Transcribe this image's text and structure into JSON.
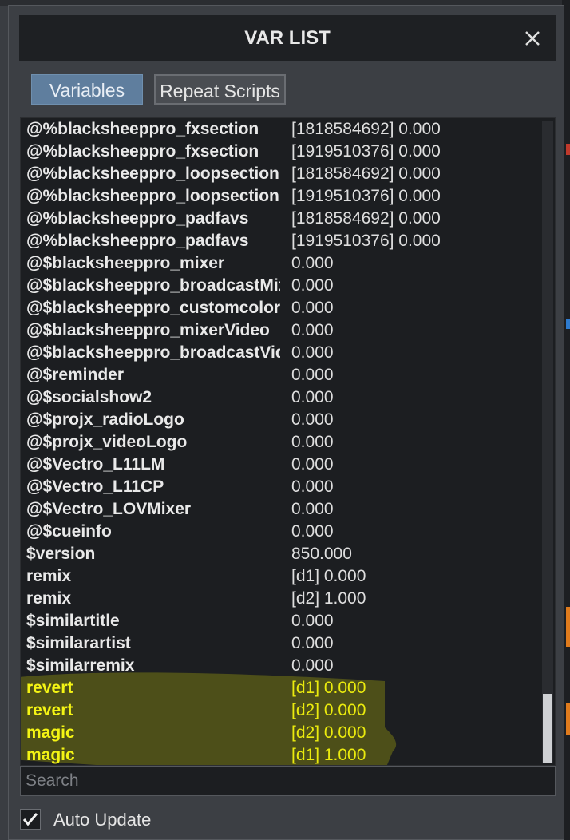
{
  "window": {
    "title": "VAR LIST",
    "close_icon": "close-icon"
  },
  "tabs": [
    {
      "label": "Variables",
      "active": true
    },
    {
      "label": "Repeat Scripts",
      "active": false
    }
  ],
  "variables": [
    {
      "name": "@%blacksheeppro_fxsection",
      "value": "[1818584692] 0.000",
      "highlighted": false
    },
    {
      "name": "@%blacksheeppro_fxsection",
      "value": "[1919510376] 0.000",
      "highlighted": false
    },
    {
      "name": "@%blacksheeppro_loopsection",
      "value": "[1818584692] 0.000",
      "highlighted": false
    },
    {
      "name": "@%blacksheeppro_loopsection",
      "value": "[1919510376] 0.000",
      "highlighted": false
    },
    {
      "name": "@%blacksheeppro_padfavs",
      "value": "[1818584692] 0.000",
      "highlighted": false
    },
    {
      "name": "@%blacksheeppro_padfavs",
      "value": "[1919510376] 0.000",
      "highlighted": false
    },
    {
      "name": "@$blacksheeppro_mixer",
      "value": "0.000",
      "highlighted": false
    },
    {
      "name": "@$blacksheeppro_broadcastMixer",
      "value": "0.000",
      "highlighted": false
    },
    {
      "name": "@$blacksheeppro_customcolors",
      "value": "0.000",
      "highlighted": false
    },
    {
      "name": "@$blacksheeppro_mixerVideo",
      "value": "0.000",
      "highlighted": false
    },
    {
      "name": "@$blacksheeppro_broadcastVideo",
      "value": "0.000",
      "highlighted": false
    },
    {
      "name": "@$reminder",
      "value": "0.000",
      "highlighted": false
    },
    {
      "name": "@$socialshow2",
      "value": "0.000",
      "highlighted": false
    },
    {
      "name": "@$projx_radioLogo",
      "value": "0.000",
      "highlighted": false
    },
    {
      "name": "@$projx_videoLogo",
      "value": "0.000",
      "highlighted": false
    },
    {
      "name": "@$Vectro_L11LM",
      "value": "0.000",
      "highlighted": false
    },
    {
      "name": "@$Vectro_L11CP",
      "value": "0.000",
      "highlighted": false
    },
    {
      "name": "@$Vectro_LOVMixer",
      "value": "0.000",
      "highlighted": false
    },
    {
      "name": "@$cueinfo",
      "value": "0.000",
      "highlighted": false
    },
    {
      "name": "$version",
      "value": "850.000",
      "highlighted": false
    },
    {
      "name": "remix",
      "value": "[d1] 0.000",
      "highlighted": false
    },
    {
      "name": "remix",
      "value": "[d2] 1.000",
      "highlighted": false
    },
    {
      "name": "$similartitle",
      "value": "0.000",
      "highlighted": false
    },
    {
      "name": "$similarartist",
      "value": "0.000",
      "highlighted": false
    },
    {
      "name": "$similarremix",
      "value": "0.000",
      "highlighted": false
    },
    {
      "name": "revert",
      "value": "[d1] 0.000",
      "highlighted": true
    },
    {
      "name": "revert",
      "value": "[d2] 0.000",
      "highlighted": true
    },
    {
      "name": "magic",
      "value": "[d2] 0.000",
      "highlighted": true
    },
    {
      "name": "magic",
      "value": "[d1] 1.000",
      "highlighted": true
    }
  ],
  "search": {
    "placeholder": "Search",
    "value": ""
  },
  "auto_update": {
    "label": "Auto Update",
    "checked": true
  },
  "colors": {
    "highlight_marker": "#ffff00",
    "highlight_text": "#f1f11a",
    "active_tab": "#5f7e9e"
  }
}
